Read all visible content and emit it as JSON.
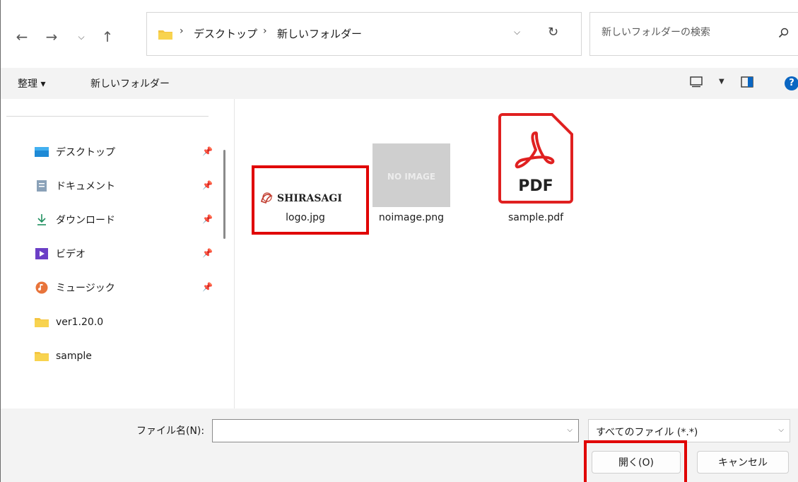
{
  "address_bar": {
    "breadcrumb": [
      "デスクトップ",
      "新しいフォルダー"
    ],
    "search_placeholder": "新しいフォルダーの検索"
  },
  "command_bar": {
    "organize_label": "整理 ▾",
    "new_folder_label": "新しいフォルダー"
  },
  "nav_pane": {
    "items": [
      {
        "label": "デスクトップ",
        "icon": "desktop-icon",
        "pinned": true
      },
      {
        "label": "ドキュメント",
        "icon": "document-icon",
        "pinned": true
      },
      {
        "label": "ダウンロード",
        "icon": "download-icon",
        "pinned": true
      },
      {
        "label": "ビデオ",
        "icon": "video-icon",
        "pinned": true
      },
      {
        "label": "ミュージック",
        "icon": "music-icon",
        "pinned": true
      },
      {
        "label": "ver1.20.0",
        "icon": "folder-icon",
        "pinned": false
      },
      {
        "label": "sample",
        "icon": "folder-icon",
        "pinned": false
      }
    ]
  },
  "files": [
    {
      "name": "logo.jpg",
      "thumb_text": "SHIRASAGI",
      "highlighted": true
    },
    {
      "name": "noimage.png",
      "thumb_text": "NO IMAGE",
      "highlighted": false
    },
    {
      "name": "sample.pdf",
      "thumb_text": "PDF",
      "highlighted": false
    }
  ],
  "bottom": {
    "filename_label": "ファイル名(N):",
    "filename_value": "",
    "file_type": "すべてのファイル (*.*)",
    "open_button": "開く(O)",
    "cancel_button": "キャンセル"
  },
  "colors": {
    "highlight": "#e00000",
    "accent": "#0a66c2",
    "folder": "#f4c542"
  }
}
